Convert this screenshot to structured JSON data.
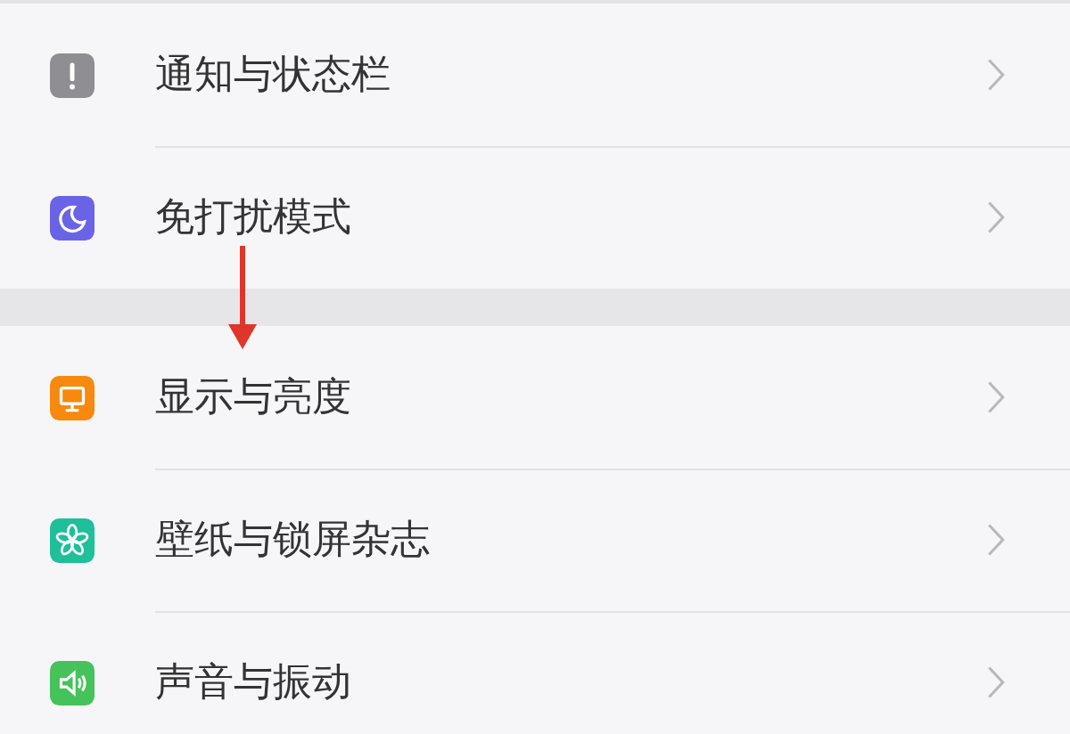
{
  "groups": [
    {
      "items": [
        {
          "kind": "notification",
          "label": "通知与状态栏",
          "color": "#8e8e93"
        },
        {
          "kind": "moon",
          "label": "免打扰模式",
          "color": "#6b63e6"
        }
      ]
    },
    {
      "items": [
        {
          "kind": "display",
          "label": "显示与亮度",
          "color": "#f7890f"
        },
        {
          "kind": "flower",
          "label": "壁纸与锁屏杂志",
          "color": "#1fbf9a"
        },
        {
          "kind": "sound",
          "label": "声音与振动",
          "color": "#45c35a"
        }
      ]
    }
  ]
}
